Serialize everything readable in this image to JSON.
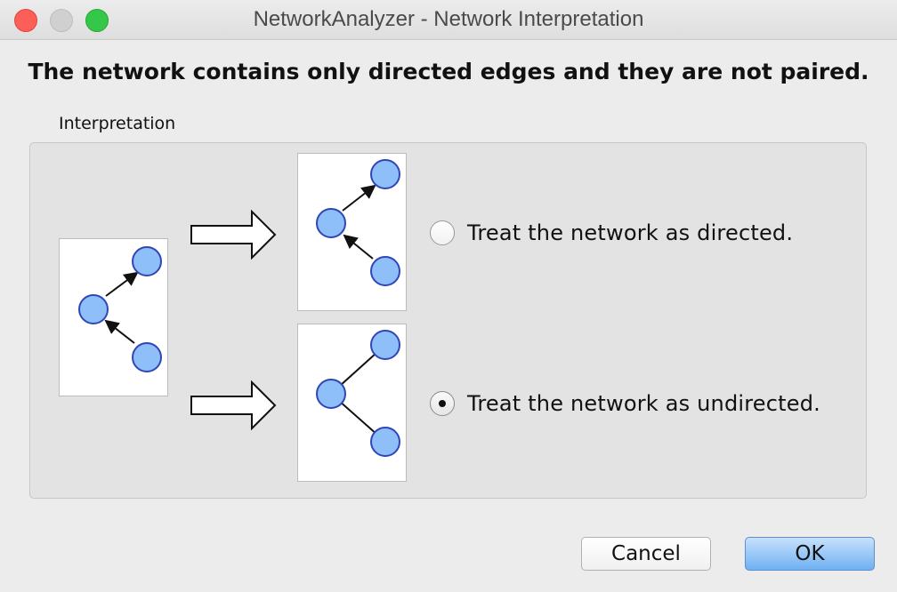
{
  "window": {
    "title": "NetworkAnalyzer - Network Interpretation"
  },
  "message": "The network contains only directed edges and they are not paired.",
  "group": {
    "label": "Interpretation"
  },
  "options": [
    {
      "label": "Treat the network as directed.",
      "selected": false
    },
    {
      "label": "Treat the network as undirected.",
      "selected": true
    }
  ],
  "buttons": {
    "cancel": "Cancel",
    "ok": "OK"
  },
  "colors": {
    "node_fill": "#8fbff8",
    "node_stroke": "#2f46b8",
    "ok_button": "#6fb0f3"
  }
}
